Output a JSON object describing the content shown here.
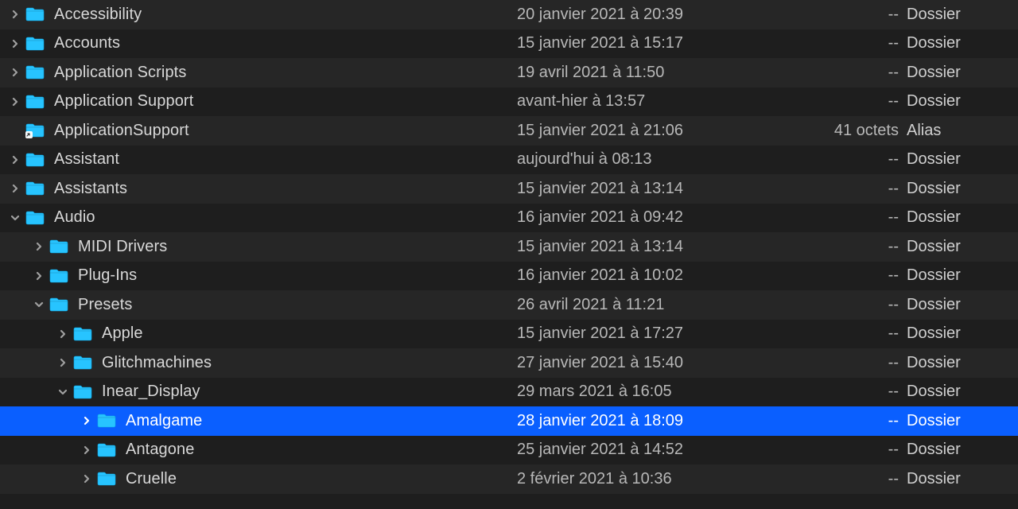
{
  "rows": [
    {
      "indent": 0,
      "disclosure": "right",
      "icon": "folder",
      "name": "Accessibility",
      "date": "20 janvier 2021 à 20:39",
      "size": "--",
      "kind": "Dossier",
      "stripe": "a",
      "selected": false
    },
    {
      "indent": 0,
      "disclosure": "right",
      "icon": "folder",
      "name": "Accounts",
      "date": "15 janvier 2021 à 15:17",
      "size": "--",
      "kind": "Dossier",
      "stripe": "b",
      "selected": false
    },
    {
      "indent": 0,
      "disclosure": "right",
      "icon": "folder",
      "name": "Application Scripts",
      "date": "19 avril 2021 à 11:50",
      "size": "--",
      "kind": "Dossier",
      "stripe": "a",
      "selected": false
    },
    {
      "indent": 0,
      "disclosure": "right",
      "icon": "folder",
      "name": "Application Support",
      "date": "avant-hier à 13:57",
      "size": "--",
      "kind": "Dossier",
      "stripe": "b",
      "selected": false
    },
    {
      "indent": 0,
      "disclosure": "none",
      "icon": "alias",
      "name": "ApplicationSupport",
      "date": "15 janvier 2021 à 21:06",
      "size": "41 octets",
      "kind": "Alias",
      "stripe": "a",
      "selected": false
    },
    {
      "indent": 0,
      "disclosure": "right",
      "icon": "folder",
      "name": "Assistant",
      "date": "aujourd'hui à 08:13",
      "size": "--",
      "kind": "Dossier",
      "stripe": "b",
      "selected": false
    },
    {
      "indent": 0,
      "disclosure": "right",
      "icon": "folder",
      "name": "Assistants",
      "date": "15 janvier 2021 à 13:14",
      "size": "--",
      "kind": "Dossier",
      "stripe": "a",
      "selected": false
    },
    {
      "indent": 0,
      "disclosure": "down",
      "icon": "folder",
      "name": "Audio",
      "date": "16 janvier 2021 à 09:42",
      "size": "--",
      "kind": "Dossier",
      "stripe": "b",
      "selected": false
    },
    {
      "indent": 1,
      "disclosure": "right",
      "icon": "folder",
      "name": "MIDI Drivers",
      "date": "15 janvier 2021 à 13:14",
      "size": "--",
      "kind": "Dossier",
      "stripe": "a",
      "selected": false
    },
    {
      "indent": 1,
      "disclosure": "right",
      "icon": "folder",
      "name": "Plug-Ins",
      "date": "16 janvier 2021 à 10:02",
      "size": "--",
      "kind": "Dossier",
      "stripe": "b",
      "selected": false
    },
    {
      "indent": 1,
      "disclosure": "down",
      "icon": "folder",
      "name": "Presets",
      "date": "26 avril 2021 à 11:21",
      "size": "--",
      "kind": "Dossier",
      "stripe": "a",
      "selected": false
    },
    {
      "indent": 2,
      "disclosure": "right",
      "icon": "folder",
      "name": "Apple",
      "date": "15 janvier 2021 à 17:27",
      "size": "--",
      "kind": "Dossier",
      "stripe": "b",
      "selected": false
    },
    {
      "indent": 2,
      "disclosure": "right",
      "icon": "folder",
      "name": "Glitchmachines",
      "date": "27 janvier 2021 à 15:40",
      "size": "--",
      "kind": "Dossier",
      "stripe": "a",
      "selected": false
    },
    {
      "indent": 2,
      "disclosure": "down",
      "icon": "folder",
      "name": "Inear_Display",
      "date": "29 mars 2021 à 16:05",
      "size": "--",
      "kind": "Dossier",
      "stripe": "b",
      "selected": false
    },
    {
      "indent": 3,
      "disclosure": "right",
      "icon": "folder",
      "name": "Amalgame",
      "date": "28 janvier 2021 à 18:09",
      "size": "--",
      "kind": "Dossier",
      "stripe": "a",
      "selected": true
    },
    {
      "indent": 3,
      "disclosure": "right",
      "icon": "folder",
      "name": "Antagone",
      "date": "25 janvier 2021 à 14:52",
      "size": "--",
      "kind": "Dossier",
      "stripe": "b",
      "selected": false
    },
    {
      "indent": 3,
      "disclosure": "right",
      "icon": "folder",
      "name": "Cruelle",
      "date": "2 février 2021 à 10:36",
      "size": "--",
      "kind": "Dossier",
      "stripe": "a",
      "selected": false
    }
  ],
  "icons": {
    "folder_fill": "#27c4ff",
    "folder_stroke": "#0aa7e6"
  }
}
